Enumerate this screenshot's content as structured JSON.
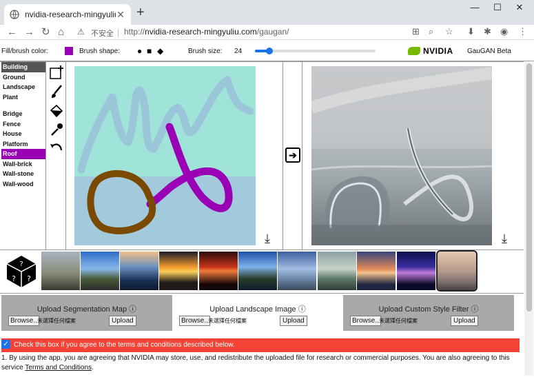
{
  "browser": {
    "tab_title": "nvidia-research-mingyuliu.com",
    "new_tab": "+",
    "insecure_label": "不安全",
    "url_scheme": "http://",
    "url_host": "nvidia-research-mingyuliu.com",
    "url_path": "/gaugan/"
  },
  "controls": {
    "fill_label": "Fill/brush color:",
    "fill_color": "#9a00b4",
    "shape_label": "Brush shape:",
    "size_label": "Brush size:",
    "size_value": "24",
    "size_fraction": 0.12,
    "brand": "NVIDIA",
    "app_name": "GauGAN Beta"
  },
  "labels": {
    "group1": [
      "Building",
      "Ground",
      "Landscape",
      "Plant"
    ],
    "group2": [
      "Bridge",
      "Fence",
      "House",
      "Platform",
      "Roof",
      "Wall-brick",
      "Wall-stone",
      "Wall-wood"
    ]
  },
  "uploads": [
    {
      "title": "Upload Segmentation Map",
      "browse": "Browse..",
      "nofile": "未選擇任何檔案",
      "upload": "Upload"
    },
    {
      "title": "Upload Landscape Image",
      "browse": "Browse..",
      "nofile": "未選擇任何檔案",
      "upload": "Upload"
    },
    {
      "title": "Upload Custom Style Filter",
      "browse": "Browse..",
      "nofile": "未選擇任何檔案",
      "upload": "Upload"
    }
  ],
  "terms": {
    "checkbox_text": "Check this box if you agree to the terms and conditions described below.",
    "para1": "1. By using the app, you are agreeing that NVIDIA may store, use, and redistribute the uploaded file for research or commercial purposes. You are also agreeing to this service",
    "link": "Terms and Conditions",
    "para1_end": "."
  }
}
